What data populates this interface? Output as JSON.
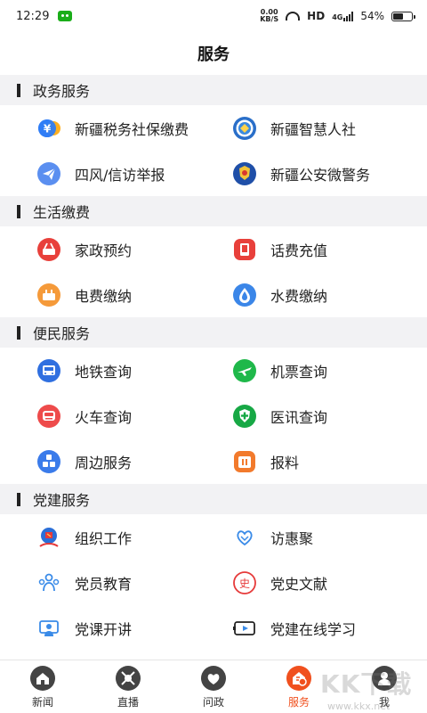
{
  "status": {
    "time": "12:29",
    "net_speed_value": "0.00",
    "net_speed_unit": "KB/S",
    "network": "HD",
    "network_gen": "4G",
    "battery": "54%",
    "battery_level": 0.54
  },
  "header": {
    "title": "服务"
  },
  "sections": [
    {
      "title": "政务服务",
      "items": [
        "新疆税务社保缴费",
        "新疆智慧人社",
        "四风/信访举报",
        "新疆公安微警务"
      ]
    },
    {
      "title": "生活缴费",
      "items": [
        "家政预约",
        "话费充值",
        "电费缴纳",
        "水费缴纳"
      ]
    },
    {
      "title": "便民服务",
      "items": [
        "地铁查询",
        "机票查询",
        "火车查询",
        "医讯查询",
        "周边服务",
        "报料"
      ]
    },
    {
      "title": "党建服务",
      "items": [
        "组织工作",
        "访惠聚",
        "党员教育",
        "党史文献",
        "党课开讲",
        "党建在线学习"
      ]
    }
  ],
  "icons": {
    "tax": "yuan-coin-icon",
    "hr": "emblem-icon",
    "report": "paper-plane-icon",
    "police": "police-badge-icon",
    "housekeeping": "basket-icon",
    "phone": "phone-icon",
    "electricity": "plug-icon",
    "water": "water-drop-icon",
    "metro": "bus-icon",
    "flight": "airplane-icon",
    "train": "train-icon",
    "medical": "shield-cross-icon",
    "nearby": "blocks-icon",
    "report2": "box-icon",
    "org": "party-flag-icon",
    "fhj": "heart-hands-icon",
    "edu": "people-icon",
    "history": "history-seal-icon",
    "lecture": "presenter-icon",
    "online": "video-play-icon"
  },
  "tabs": [
    {
      "label": "新闻",
      "icon": "home-icon"
    },
    {
      "label": "直播",
      "icon": "live-icon"
    },
    {
      "label": "问政",
      "icon": "heart-chat-icon"
    },
    {
      "label": "服务",
      "icon": "service-icon"
    },
    {
      "label": "我",
      "icon": "user-icon"
    }
  ],
  "colors": {
    "accent": "#f0501e",
    "section_bg": "#f2f2f4"
  },
  "watermark": {
    "text": "KK下载",
    "url": "www.kkx.net"
  }
}
